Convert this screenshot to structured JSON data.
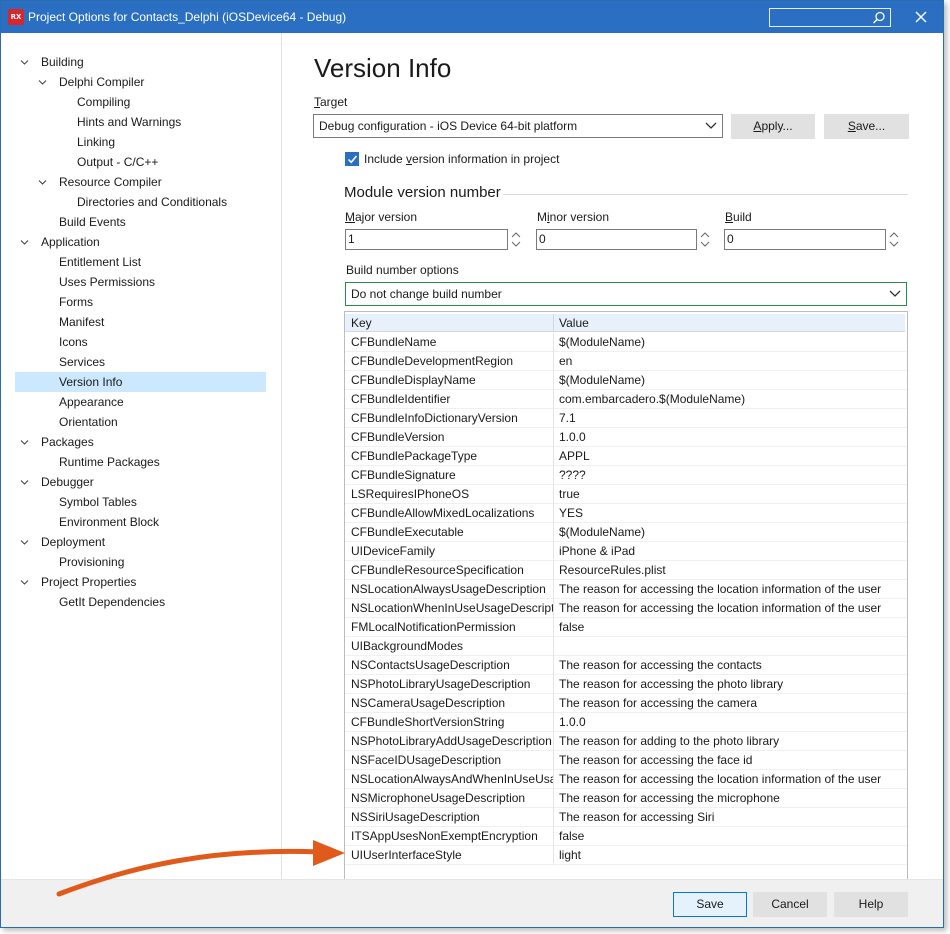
{
  "window": {
    "title": "Project Options for Contacts_Delphi  (iOSDevice64 - Debug)",
    "app_icon_text": "RX"
  },
  "tree": [
    {
      "label": "Building",
      "level": 0,
      "expanded": true
    },
    {
      "label": "Delphi Compiler",
      "level": 1,
      "expanded": true
    },
    {
      "label": "Compiling",
      "level": 2
    },
    {
      "label": "Hints and Warnings",
      "level": 2
    },
    {
      "label": "Linking",
      "level": 2
    },
    {
      "label": "Output - C/C++",
      "level": 2
    },
    {
      "label": "Resource Compiler",
      "level": 1,
      "expanded": true
    },
    {
      "label": "Directories and Conditionals",
      "level": 2
    },
    {
      "label": "Build Events",
      "level": 1
    },
    {
      "label": "Application",
      "level": 0,
      "expanded": true
    },
    {
      "label": "Entitlement List",
      "level": 1
    },
    {
      "label": "Uses Permissions",
      "level": 1
    },
    {
      "label": "Forms",
      "level": 1
    },
    {
      "label": "Manifest",
      "level": 1
    },
    {
      "label": "Icons",
      "level": 1
    },
    {
      "label": "Services",
      "level": 1
    },
    {
      "label": "Version Info",
      "level": 1,
      "selected": true
    },
    {
      "label": "Appearance",
      "level": 1
    },
    {
      "label": "Orientation",
      "level": 1
    },
    {
      "label": "Packages",
      "level": 0,
      "expanded": true
    },
    {
      "label": "Runtime Packages",
      "level": 1
    },
    {
      "label": "Debugger",
      "level": 0,
      "expanded": true
    },
    {
      "label": "Symbol Tables",
      "level": 1
    },
    {
      "label": "Environment Block",
      "level": 1
    },
    {
      "label": "Deployment",
      "level": 0,
      "expanded": true
    },
    {
      "label": "Provisioning",
      "level": 1
    },
    {
      "label": "Project Properties",
      "level": 0,
      "expanded": true
    },
    {
      "label": "GetIt Dependencies",
      "level": 1
    }
  ],
  "page": {
    "title": "Version Info",
    "target_label": "Target",
    "target_value": "Debug configuration - iOS Device 64-bit platform",
    "apply_label": "Apply...",
    "save_label": "Save...",
    "include_version_label": "Include version information in project",
    "include_version_checked": true,
    "module_version_title": "Module version number",
    "major_label": "Major version",
    "major_value": "1",
    "minor_label": "Minor version",
    "minor_value": "0",
    "build_label": "Build",
    "build_value": "0",
    "build_options_label": "Build number options",
    "build_options_value": "Do not change build number"
  },
  "grid": {
    "columns": [
      "Key",
      "Value"
    ],
    "rows": [
      [
        "CFBundleName",
        "$(ModuleName)"
      ],
      [
        "CFBundleDevelopmentRegion",
        "en"
      ],
      [
        "CFBundleDisplayName",
        "$(ModuleName)"
      ],
      [
        "CFBundleIdentifier",
        "com.embarcadero.$(ModuleName)"
      ],
      [
        "CFBundleInfoDictionaryVersion",
        "7.1"
      ],
      [
        "CFBundleVersion",
        "1.0.0"
      ],
      [
        "CFBundlePackageType",
        "APPL"
      ],
      [
        "CFBundleSignature",
        "????"
      ],
      [
        "LSRequiresIPhoneOS",
        "true"
      ],
      [
        "CFBundleAllowMixedLocalizations",
        "YES"
      ],
      [
        "CFBundleExecutable",
        "$(ModuleName)"
      ],
      [
        "UIDeviceFamily",
        "iPhone & iPad"
      ],
      [
        "CFBundleResourceSpecification",
        "ResourceRules.plist"
      ],
      [
        "NSLocationAlwaysUsageDescription",
        "The reason for accessing the location information of the user"
      ],
      [
        "NSLocationWhenInUseUsageDescription",
        "The reason for accessing the location information of the user"
      ],
      [
        "FMLocalNotificationPermission",
        "false"
      ],
      [
        "UIBackgroundModes",
        ""
      ],
      [
        "NSContactsUsageDescription",
        "The reason for accessing the contacts"
      ],
      [
        "NSPhotoLibraryUsageDescription",
        "The reason for accessing the photo library"
      ],
      [
        "NSCameraUsageDescription",
        "The reason for accessing the camera"
      ],
      [
        "CFBundleShortVersionString",
        "1.0.0"
      ],
      [
        "NSPhotoLibraryAddUsageDescription",
        "The reason for adding to the photo library"
      ],
      [
        "NSFaceIDUsageDescription",
        "The reason for accessing the face id"
      ],
      [
        "NSLocationAlwaysAndWhenInUseUsageDescription",
        "The reason for accessing the location information of the user"
      ],
      [
        "NSMicrophoneUsageDescription",
        "The reason for accessing the microphone"
      ],
      [
        "NSSiriUsageDescription",
        "The reason for accessing Siri"
      ],
      [
        "ITSAppUsesNonExemptEncryption",
        "false"
      ],
      [
        "UIUserInterfaceStyle",
        "light"
      ]
    ]
  },
  "footer": {
    "save_label": "Save",
    "cancel_label": "Cancel",
    "help_label": "Help"
  },
  "colors": {
    "titlebar": "#2a6fc1",
    "selection": "#cce8ff",
    "arrow": "#e05a1c"
  },
  "icons": {
    "app": "app-icon",
    "search": "search-icon",
    "close": "close-icon",
    "arrow": "annotation-arrow"
  }
}
